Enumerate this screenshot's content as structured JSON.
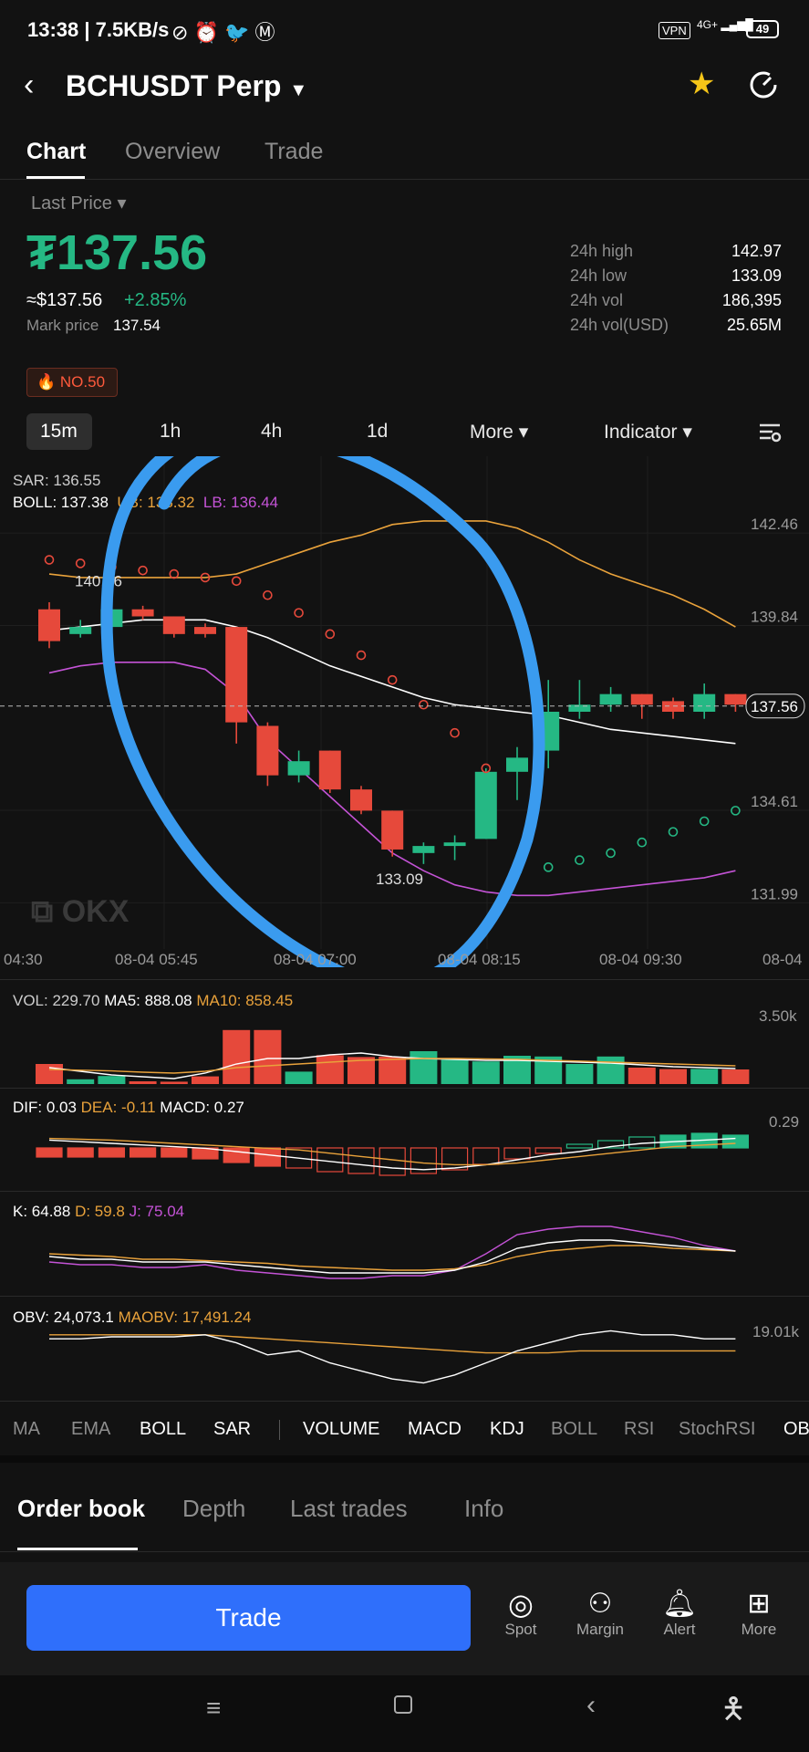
{
  "status": {
    "time": "13:38",
    "speed": "7.5KB/s",
    "vpn": "VPN",
    "signal": "4G+",
    "battery": "49"
  },
  "header": {
    "title": "BCHUSDT Perp"
  },
  "tabs": [
    "Chart",
    "Overview",
    "Trade"
  ],
  "price": {
    "selector": "Last Price",
    "last": "₮137.56",
    "approx": "≈$137.56",
    "change": "+2.85%",
    "mark_label": "Mark price",
    "mark_value": "137.54"
  },
  "stats": [
    {
      "label": "24h high",
      "value": "142.97"
    },
    {
      "label": "24h low",
      "value": "133.09"
    },
    {
      "label": "24h vol",
      "value": "186,395"
    },
    {
      "label": "24h vol(USD)",
      "value": "25.65M"
    }
  ],
  "rank_badge": "NO.50",
  "timeframes": {
    "t1": "15m",
    "t2": "1h",
    "t3": "4h",
    "t4": "1d",
    "more": "More",
    "indicator": "Indicator"
  },
  "overlay": {
    "sar": "SAR: 136.55",
    "boll": "BOLL: 137.38",
    "ub": "UB: 138.32",
    "lb": "LB: 136.44"
  },
  "chart_data": {
    "type": "candlestick",
    "y_ticks": [
      "142.46",
      "139.84",
      "134.61",
      "131.99"
    ],
    "current_price": "137.56",
    "high_label": "140.76",
    "low_label": "133.09",
    "x_ticks": [
      "04:30",
      "08-04 05:45",
      "08-04 07:00",
      "08-04 08:15",
      "08-04 09:30",
      "08-04"
    ],
    "candles": [
      [
        140.3,
        139.4,
        140.5,
        139.2
      ],
      [
        139.6,
        139.8,
        140.0,
        139.5
      ],
      [
        139.8,
        140.3,
        140.8,
        139.7
      ],
      [
        140.3,
        140.1,
        140.4,
        140.0
      ],
      [
        140.1,
        139.6,
        140.1,
        139.5
      ],
      [
        139.8,
        139.6,
        139.9,
        139.5
      ],
      [
        139.8,
        137.1,
        139.8,
        136.5
      ],
      [
        137.0,
        135.6,
        137.1,
        135.3
      ],
      [
        135.6,
        136.0,
        136.3,
        135.4
      ],
      [
        136.3,
        135.2,
        136.3,
        135.1
      ],
      [
        135.2,
        134.6,
        135.3,
        134.5
      ],
      [
        134.6,
        133.5,
        134.6,
        133.3
      ],
      [
        133.4,
        133.6,
        133.7,
        133.09
      ],
      [
        133.6,
        133.7,
        133.9,
        133.2
      ],
      [
        133.8,
        135.7,
        135.8,
        133.8
      ],
      [
        135.7,
        136.1,
        136.4,
        134.9
      ],
      [
        136.3,
        137.4,
        138.3,
        135.8
      ],
      [
        137.4,
        137.6,
        138.3,
        137.2
      ],
      [
        137.6,
        137.9,
        138.1,
        137.4
      ],
      [
        137.9,
        137.6,
        137.9,
        137.2
      ],
      [
        137.7,
        137.4,
        137.8,
        137.2
      ],
      [
        137.4,
        137.9,
        138.2,
        137.2
      ],
      [
        137.9,
        137.6,
        137.9,
        137.4
      ]
    ],
    "ub_line": [
      141.3,
      141.2,
      141.2,
      141.2,
      141.2,
      141.2,
      141.3,
      141.6,
      141.9,
      142.2,
      142.4,
      142.7,
      142.8,
      142.8,
      142.8,
      142.6,
      142.2,
      141.7,
      141.3,
      141.0,
      140.7,
      140.3,
      139.8
    ],
    "mid_line": [
      139.7,
      139.8,
      139.9,
      140.0,
      140.0,
      140.0,
      139.8,
      139.5,
      139.1,
      138.7,
      138.4,
      138.1,
      137.8,
      137.6,
      137.5,
      137.4,
      137.3,
      137.1,
      136.9,
      136.8,
      136.7,
      136.6,
      136.5
    ],
    "lb_line": [
      138.5,
      138.7,
      138.8,
      138.8,
      138.8,
      138.6,
      137.9,
      136.6,
      135.8,
      135.0,
      134.2,
      133.4,
      132.9,
      132.5,
      132.3,
      132.2,
      132.2,
      132.3,
      132.4,
      132.5,
      132.6,
      132.7,
      132.9
    ],
    "sar_points": [
      141.7,
      141.6,
      141.5,
      141.4,
      141.3,
      141.2,
      141.1,
      140.7,
      140.2,
      139.6,
      139.0,
      138.3,
      137.6,
      136.8,
      135.8,
      132.9,
      133.0,
      133.2,
      133.4,
      133.7,
      134.0,
      134.3,
      134.6
    ],
    "volume": {
      "label": "VOL: 229.70",
      "ma5": "MA5: 888.08",
      "ma10": "MA10: 858.45",
      "max_tick": "3.50k",
      "bars": [
        1100,
        260,
        440,
        150,
        130,
        420,
        2960,
        2960,
        680,
        1580,
        1480,
        1500,
        1800,
        1330,
        1240,
        1550,
        1510,
        1100,
        1510,
        900,
        820,
        830,
        800
      ]
    },
    "macd": {
      "label_dif": "DIF: 0.03",
      "label_dea": "DEA: -0.11",
      "label_macd": "MACD: 0.27",
      "max_tick": "0.29"
    },
    "kdj": {
      "label_k": "K: 64.88",
      "label_d": "D: 59.8",
      "label_j": "J: 75.04"
    },
    "obv": {
      "label": "OBV: 24,073.1",
      "maobv": "MAOBV: 17,491.24",
      "max_tick": "19.01k"
    }
  },
  "indicator_tabs": [
    "MA",
    "EMA",
    "BOLL",
    "SAR",
    "VOLUME",
    "MACD",
    "KDJ",
    "BOLL",
    "RSI",
    "StochRSI",
    "OB"
  ],
  "bottom_tabs": [
    "Order book",
    "Depth",
    "Last trades",
    "Info"
  ],
  "actions": {
    "trade": "Trade",
    "spot": "Spot",
    "margin": "Margin",
    "alert": "Alert",
    "more": "More"
  },
  "colors": {
    "up": "#25b884",
    "down": "#e6493b",
    "accent": "#2f6ffb",
    "annotation": "#3a9bef",
    "ma5": "#ffffff",
    "ma10": "#e9a23b",
    "purple": "#c453d6"
  }
}
